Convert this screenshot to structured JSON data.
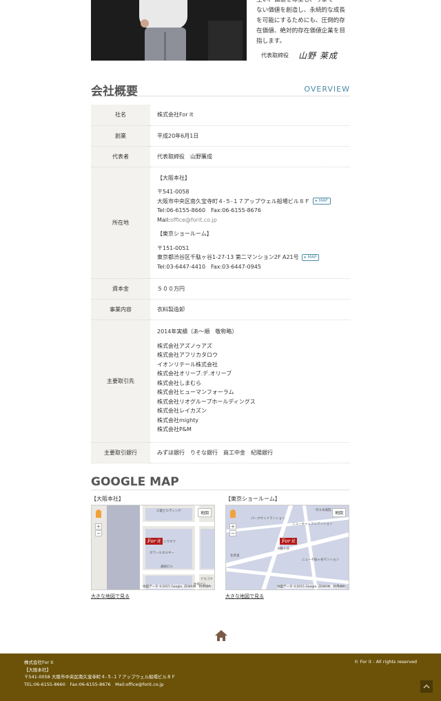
{
  "hero": {
    "message_lines": [
      "生い、価値を尊重し、今まで",
      "ない価値を創造し、永続的な成長",
      "を可能にするためにも、圧倒的存",
      "在価値、絶対的存在価値企業を目",
      "指します。"
    ],
    "signature_role": "代表取締役",
    "signature_name": "山野 莱成"
  },
  "overview": {
    "title": "会社概要",
    "subtitle": "OVERVIEW"
  },
  "company": {
    "name_label": "社名",
    "name_value": "株式会社For it",
    "founded_label": "創業",
    "founded_value": "平成20年6月1日",
    "rep_label": "代表者",
    "rep_value": "代表取締役　山野簾成",
    "address_label": "所在地",
    "osaka": {
      "heading": "【大阪本社】",
      "zip": "〒541-0058",
      "address": "大阪市中央区南久宝寺町４-５-１７アップウェル船場ビル８Ｆ",
      "map_btn": "▸ MAP",
      "tel_fax": "Tel:06-6155-8660　Fax:06-6155-8676",
      "mail_label": "Mail:",
      "mail_value": "office@forit.co.jp"
    },
    "tokyo": {
      "heading": "【東京ショールーム】",
      "zip": "〒151-0051",
      "address": "東京都渋谷区千駄ヶ谷1-27-13 第二マンション2F A21号",
      "map_btn": "▸ MAP",
      "tel_fax": "Tel:03-6447-4410　Fax:03-6447-0945"
    },
    "capital_label": "資本金",
    "capital_value": "５００万円",
    "business_label": "事業内容",
    "business_value": "衣料製造卸",
    "clients_label": "主要取引先",
    "clients_note": "2014年実績（あ～順　敬称略）",
    "clients": [
      "株式会社アズノゥアズ",
      "株式会社アフリカタロウ",
      "イオンリテール株式会社",
      "株式会社オリーブ.デ.オリーブ",
      "株式会社しまむら",
      "株式会社ヒューマンフォーラム",
      "株式会社リオグループホールディングス",
      "株式会社レイカズン",
      "株式会社mighty",
      "株式会社P&M"
    ],
    "banks_label": "主要取引銀行",
    "banks_value": "みずほ銀行　りそな銀行　商工中金　紀陽銀行"
  },
  "google_map": {
    "title": "GOOGLE MAP",
    "osaka_label": "【大阪本社】",
    "tokyo_label": "【東京ショールーム】",
    "map_type_btn": "地図",
    "marker_text": "For it",
    "attribution": "地図データ ©2015 Google, ZENRIN　利用規約",
    "larger_map_link": "大きな地図で見る",
    "osaka_places": [
      "三菱ビルディング",
      "シラサワ",
      "タワーエネルギー",
      "通研ビル",
      "ナカコウ",
      "金属ビル"
    ],
    "tokyo_places": [
      "代々木病院",
      "ニューキャッスルマンション",
      "パークサイドマンション",
      "千駄ヶ谷",
      "ニュー千駄ヶ谷マンション",
      "北参道"
    ]
  },
  "footer": {
    "company": "株式会社For it",
    "office": "【大阪本社】",
    "address": "〒541-0058 大阪市中央区南久宝寺町４-５-１７アップウェル船場ビル８Ｆ",
    "contact": "TEL:06-6155-8660　Fax:06-6155-8676　Mail:office@forit.co.jp",
    "copyright": "© For it - All rights reserved"
  },
  "colors": {
    "accent": "#4a8aa8",
    "footer_bg": "#6b5208",
    "table_label_bg": "#f3f2ee",
    "map_marker": "#b31b1b",
    "home_icon": "#7a5a48"
  }
}
